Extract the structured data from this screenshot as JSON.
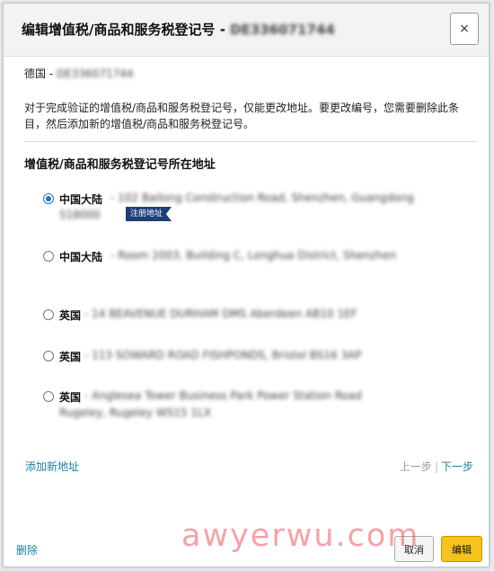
{
  "dialog": {
    "title_prefix": "编辑增值税/商品和服务税登记号 - ",
    "title_number": "DE336071744",
    "close_symbol": "×"
  },
  "vat": {
    "country": "德国 - ",
    "number": "DE336071744"
  },
  "notice": "对于完成验证的增值税/商品和服务税登记号，仅能更改地址。要更改编号，您需要删除此条目，然后添加新的增值税/商品和服务税登记号。",
  "section_title": "增值税/商品和服务税登记号所在地址",
  "addresses": [
    {
      "country": "中国大陆",
      "line1": "- 102 Bailong Construction Road, Shenzhen, Guangdong",
      "line2": "518000",
      "tag": "注册地址",
      "selected": true
    },
    {
      "country": "中国大陆",
      "line1": "- Room 2003, Building C, Longhua District, Shenzhen",
      "line2": "",
      "selected": false
    },
    {
      "country": "英国",
      "line1": "- 14 BEAVENUE DURHAM DMS Aberdeen AB10 1EF",
      "line2": "",
      "selected": false
    },
    {
      "country": "英国",
      "line1": "- 113 SOWARD ROAD FISHPONDS, Bristol BS16 3AP",
      "line2": "",
      "selected": false
    },
    {
      "country": "英国",
      "line1": "- Anglesea Tower Business Park Power Station Road",
      "line2": "Rugeley, Rugeley WS15 1LX",
      "selected": false
    }
  ],
  "links": {
    "add_address": "添加新地址",
    "prev": "上一步",
    "separator": "|",
    "next": "下一步",
    "delete": "删除"
  },
  "buttons": {
    "cancel": "取消",
    "edit": "编辑"
  },
  "watermark": "awyerwu.com",
  "colors": {
    "accent": "#1a73c9",
    "link": "#1a7fa8",
    "primary_button": "#f5c41c",
    "tag_bg": "#1d3f7a"
  }
}
